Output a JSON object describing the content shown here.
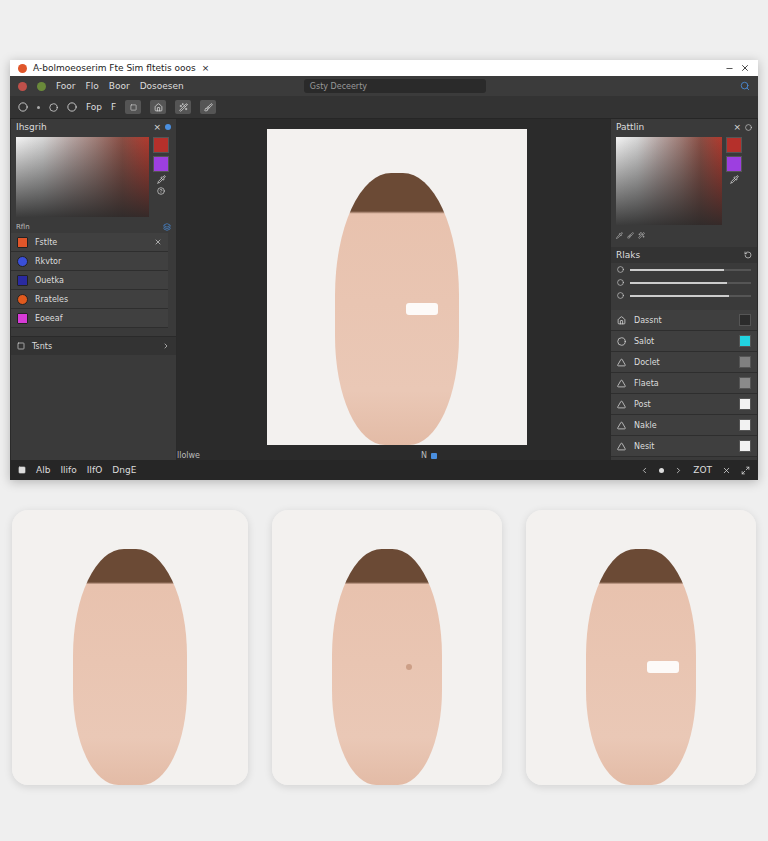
{
  "window": {
    "title": "A-bolmoeoserim Fte Sim fltetis ooos",
    "close": "×"
  },
  "menu": [
    "Foor",
    "Flo",
    "Boor",
    "Dosoesen"
  ],
  "search": {
    "placeholder": "Gsty Deceerty"
  },
  "toolbar": [
    "Fop",
    "F"
  ],
  "left_panel": {
    "title": "Ihsgrih",
    "close": "×",
    "list_label": "Rfln",
    "items": [
      {
        "label": "Fstlte",
        "color": "#e0562a"
      },
      {
        "label": "Rkvtor",
        "color": "#3a4fd8"
      },
      {
        "label": "Ouetka",
        "color": "#2a2aa0"
      },
      {
        "label": "Rrateles",
        "color": "#e05a1e"
      },
      {
        "label": "Eoeeaf",
        "color": "#d63bd6"
      }
    ],
    "footer": "Tsnts"
  },
  "canvas": {
    "caption": "llolwe",
    "badge": "N"
  },
  "right_panel": {
    "title": "Pattlin",
    "close": "×",
    "section": "Rlaks",
    "sliders": [
      {
        "level": 0.78
      },
      {
        "level": 0.8
      },
      {
        "level": 0.82
      }
    ],
    "items": [
      {
        "label": "Dassnt",
        "color": "#2b2b2b"
      },
      {
        "label": "Salot",
        "color": "#22d3e0"
      },
      {
        "label": "Doclet",
        "color": "#808080"
      },
      {
        "label": "Flaeta",
        "color": "#8a8a8a"
      },
      {
        "label": "Post",
        "color": "#f2f2f2"
      },
      {
        "label": "Nakle",
        "color": "#f2f2f2"
      },
      {
        "label": "Nesit",
        "color": "#f2f2f2"
      }
    ]
  },
  "status_bar": {
    "left": [
      "Alb",
      "Ilifo",
      "IIfO",
      "DngE"
    ],
    "right": "ZOT"
  },
  "photos": [
    {
      "variant": "clear"
    },
    {
      "variant": "freckles"
    },
    {
      "variant": "patch"
    }
  ]
}
